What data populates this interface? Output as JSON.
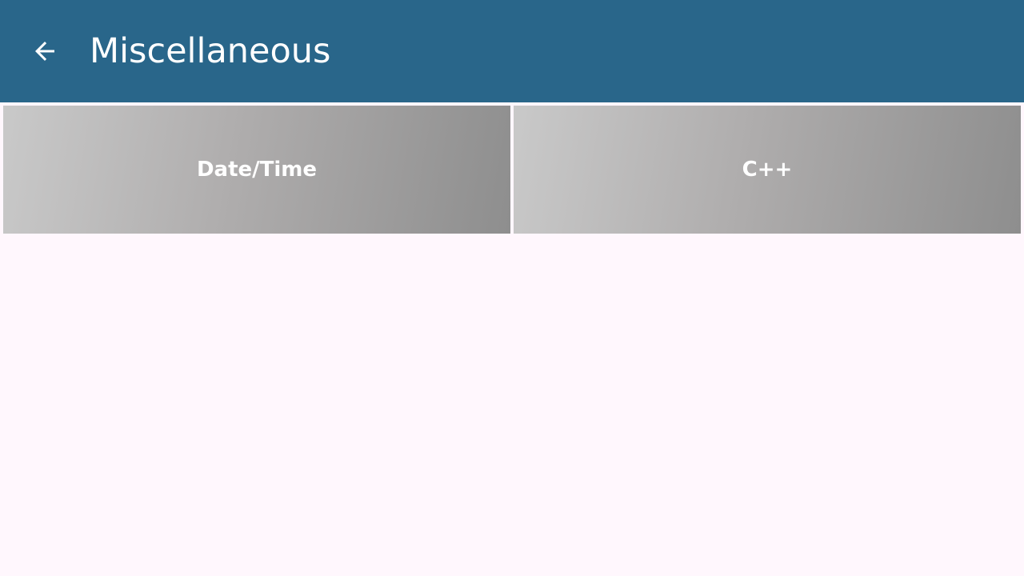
{
  "app_bar": {
    "title": "Miscellaneous",
    "back_icon": "arrow-left-icon",
    "background_color": "#29668a"
  },
  "tiles": [
    {
      "label": "Date/Time"
    },
    {
      "label": "C++"
    }
  ]
}
